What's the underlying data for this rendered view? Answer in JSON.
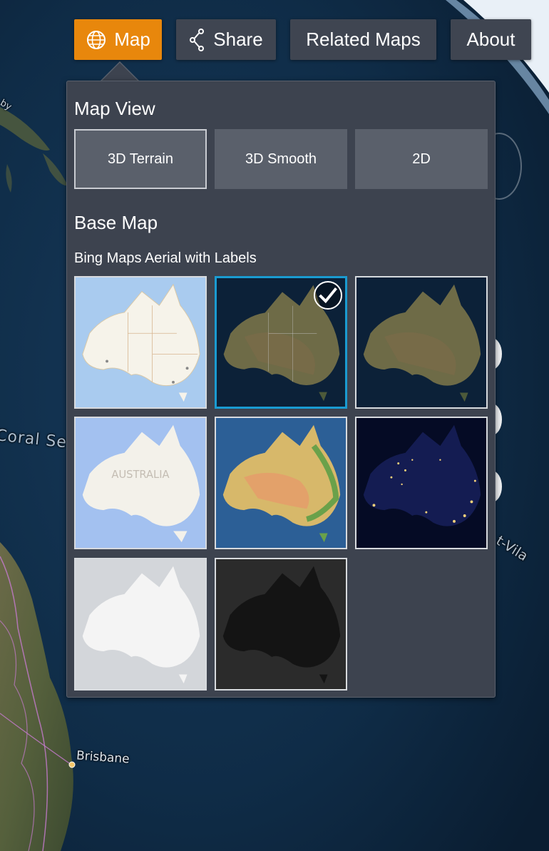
{
  "nav": {
    "map_label": "Map",
    "share_label": "Share",
    "related_label": "Related Maps",
    "about_label": "About"
  },
  "panel": {
    "map_view_title": "Map View",
    "view_options": [
      "3D Terrain",
      "3D Smooth",
      "2D"
    ],
    "active_view": "3D Terrain",
    "base_map_title": "Base Map",
    "selected_base_map": "Bing Maps Aerial with Labels",
    "base_maps": [
      {
        "style": "road"
      },
      {
        "style": "aerial-labels",
        "selected": true
      },
      {
        "style": "aerial"
      },
      {
        "style": "light-road"
      },
      {
        "style": "terrain"
      },
      {
        "style": "night-lights"
      },
      {
        "style": "positron"
      },
      {
        "style": "dark-matter"
      }
    ]
  },
  "map_labels": {
    "coral_sea": "Coral Sea",
    "brisbane": "Brisbane",
    "port_vila": "t-Vila",
    "partial_top": "by"
  },
  "thumbnail_labels": {
    "australia": "AUSTRALIA"
  },
  "colors": {
    "accent": "#e8870c",
    "selected_border": "#1a9bd1",
    "panel_bg": "#3d434f",
    "nav_bg": "#3f4551"
  }
}
